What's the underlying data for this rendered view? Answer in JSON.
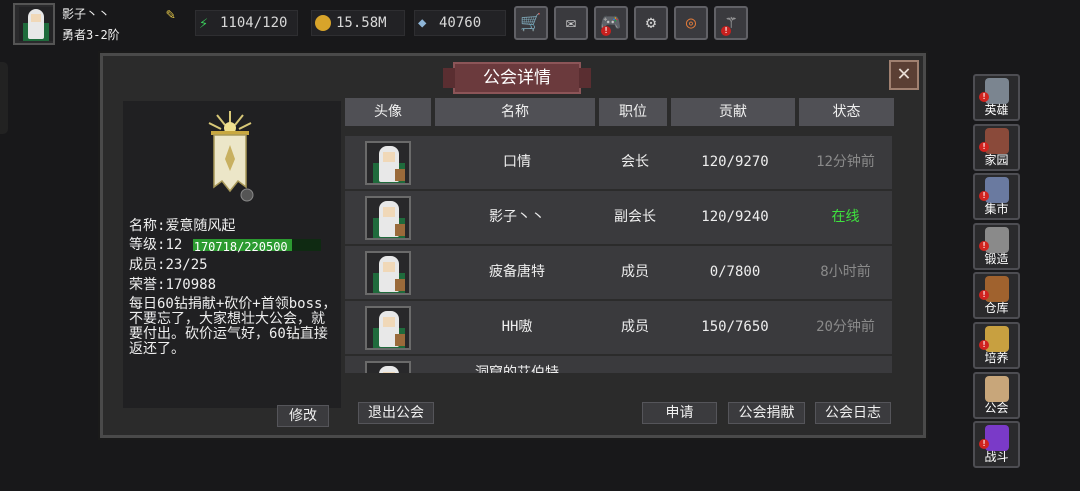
{
  "player": {
    "name": "影子丶丶",
    "rank": "勇者3-2阶"
  },
  "stats": {
    "stamina": "1104/120",
    "gold": "15.58M",
    "diamond": "40760"
  },
  "toolbar": {
    "icons": [
      "cart-icon",
      "mail-icon",
      "gamepad-icon",
      "gear-icon",
      "lottery-icon",
      "broom-icon"
    ],
    "glyphs": [
      "🛒",
      "✉",
      "🎮",
      "⚙",
      "◎",
      "⚚"
    ]
  },
  "modal": {
    "title": "公会详情",
    "close": "✕"
  },
  "guild": {
    "name_label": "名称:",
    "name": "爱意随风起",
    "level_label": "等级:",
    "level": "12",
    "xp": "170718/220500",
    "xp_fraction": 0.774,
    "members_label": "成员:",
    "members": "23/25",
    "honor_label": "荣誉:",
    "honor": "170988",
    "description": "每日60钻捐献+砍价+首领boss，不要忘了，大家想壮大公会，就要付出。砍价运气好，60钻直接返还了。",
    "edit_label": "修改"
  },
  "table": {
    "headers": [
      "头像",
      "名称",
      "职位",
      "贡献",
      "状态"
    ],
    "rows": [
      {
        "name": "口情",
        "position": "会长",
        "contribution": "120/9270",
        "status": "12分钟前",
        "online": false
      },
      {
        "name": "影子丶丶",
        "position": "副会长",
        "contribution": "120/9240",
        "status": "在线",
        "online": true
      },
      {
        "name": "疲备唐特",
        "position": "成员",
        "contribution": "0/7800",
        "status": "8小时前",
        "online": false
      },
      {
        "name": "HH嗷",
        "position": "成员",
        "contribution": "150/7650",
        "status": "20分钟前",
        "online": false
      },
      {
        "name": "洞窟的艾伯特",
        "position": "",
        "contribution": "",
        "status": "",
        "online": false
      }
    ]
  },
  "buttons": {
    "leave": "退出公会",
    "apply": "申请",
    "donate": "公会捐献",
    "log": "公会日志"
  },
  "side_menu": [
    {
      "label": "英雄",
      "color": "#7b8590",
      "alert": true
    },
    {
      "label": "家园",
      "color": "#8a4a3a",
      "alert": true
    },
    {
      "label": "集市",
      "color": "#6a7aa0",
      "alert": true
    },
    {
      "label": "锻造",
      "color": "#8a8a8a",
      "alert": true
    },
    {
      "label": "仓库",
      "color": "#a0622e",
      "alert": true
    },
    {
      "label": "培养",
      "color": "#c8a040",
      "alert": true
    },
    {
      "label": "公会",
      "color": "#c8a67a",
      "alert": false
    },
    {
      "label": "战斗",
      "color": "#7a3ac8",
      "alert": true
    }
  ],
  "colors": {
    "online": "#3ee33e",
    "offline": "#8a8a8a",
    "xp_fill": "#2c9b31"
  }
}
